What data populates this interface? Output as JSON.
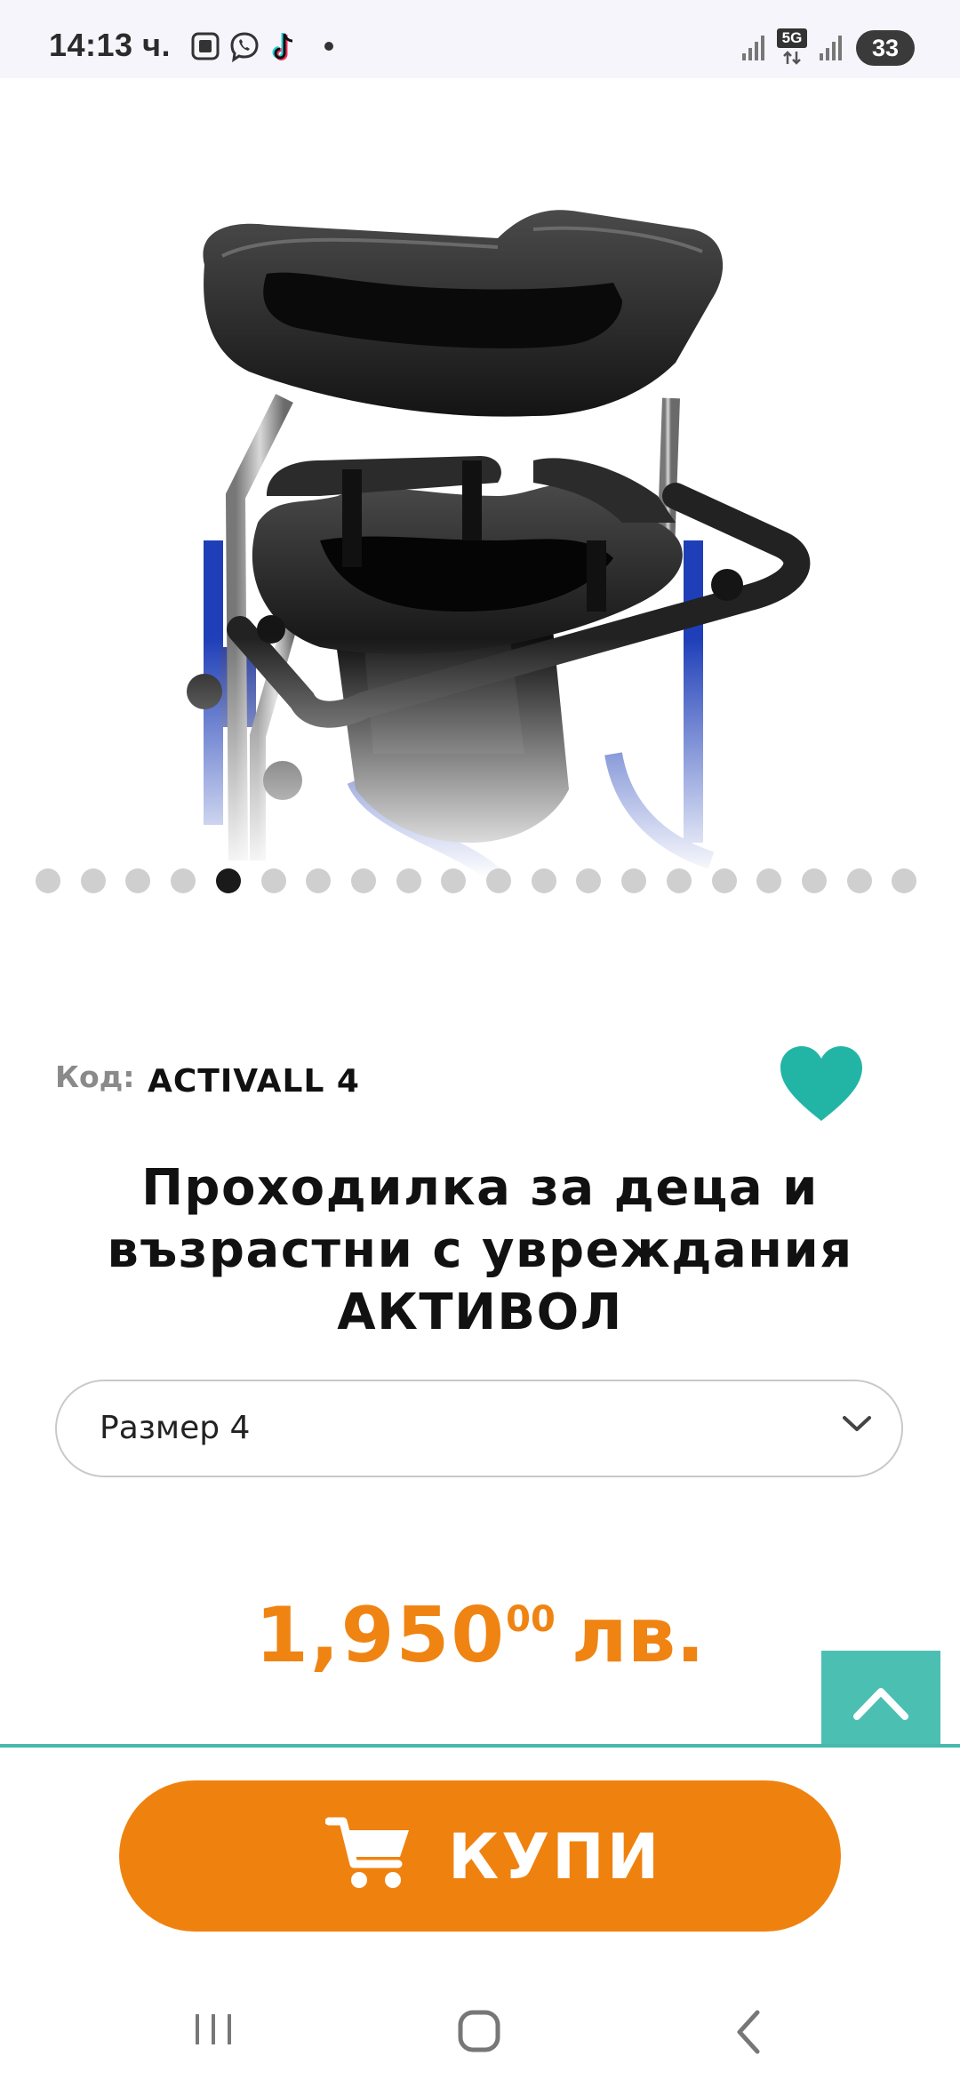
{
  "status_bar": {
    "time": "14:13 ч.",
    "battery": "33",
    "network": "5G",
    "icons": [
      "screenshot-icon",
      "viber-icon",
      "tiktok-icon",
      "notification-dot-icon",
      "signal-icon",
      "5g-icon",
      "signal-icon"
    ]
  },
  "gallery": {
    "image_alt": "walker-product-image",
    "total_slides": 20,
    "active_slide": 5
  },
  "product": {
    "code_label": "Код:",
    "code_value": "ACTIVALL 4",
    "title_line1": "Проходилка за деца и",
    "title_line2": "възрастни с увреждания",
    "title_line3": "АКТИВОЛ",
    "size_selected": "Размер 4",
    "price_main": "1,950",
    "price_sup": "00",
    "price_currency": "лв."
  },
  "buy_button": {
    "label": "КУПИ"
  },
  "colors": {
    "accent_orange": "#ef820f",
    "accent_teal": "#4cbfb3",
    "favorite": "#22b5a5"
  }
}
